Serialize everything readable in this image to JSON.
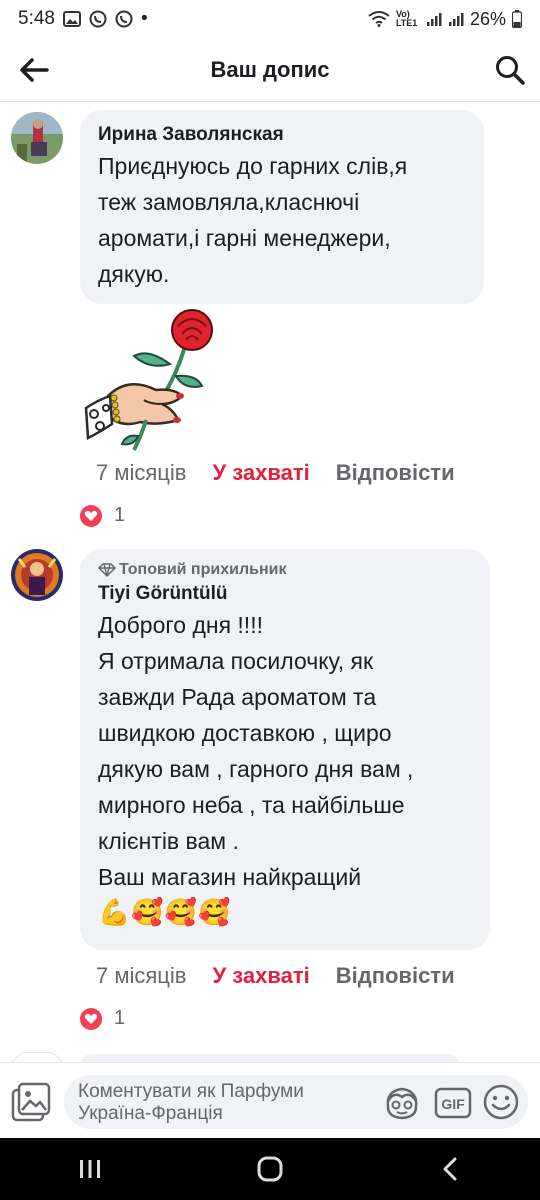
{
  "status_bar": {
    "time": "5:48",
    "dot": "•",
    "network_label": "Vo) LTE1",
    "battery": "26%",
    "icons": [
      "image-icon",
      "viber-icon",
      "viber-icon",
      "wifi-icon",
      "signal-icon",
      "signal-icon",
      "battery-icon"
    ]
  },
  "header": {
    "title": "Ваш допис",
    "back_icon": "arrow-left-icon",
    "search_icon": "search-icon"
  },
  "comments": [
    {
      "author": "Ирина Заволянская",
      "text": "Приєднуюсь до гарних слів,я\nтеж замовляла,класнючі\nаромати,і гарні менеджери,\nдякую.",
      "sticker": "hand-holding-rose-sticker",
      "time": "7 місяців",
      "like_label": "У захваті",
      "reply_label": "Відповісти",
      "reaction_icon": "heart-reaction-icon",
      "reaction_count": "1"
    },
    {
      "badge": "Топовий прихильник",
      "badge_icon": "diamond-icon",
      "author": "Tiyi Görüntülü",
      "text": "Доброго дня !!!!\nЯ отримала посилочку, як\nзавжди Рада ароматом та\nшвидкою доставкою , щиро\nдякую вам , гарного дня вам ,\nмирного неба , та найбільше\nклієнтів вам .\nВаш магазин найкращий",
      "emojis": "💪🥰🥰🥰",
      "time": "7 місяців",
      "like_label": "У захваті",
      "reply_label": "Відповісти",
      "reaction_icon": "heart-reaction-icon",
      "reaction_count": "1"
    }
  ],
  "composer": {
    "placeholder": "Коментувати як Парфуми Україна-Франція",
    "icons": [
      "photo-icon",
      "avatar-sticker-icon",
      "gif-icon",
      "emoji-icon"
    ],
    "gif_label": "GIF"
  },
  "navbar": {
    "icons": [
      "recent-apps-icon",
      "home-icon",
      "back-icon"
    ]
  },
  "colors": {
    "accent_like": "#e41e3f",
    "heart": "#f33e58",
    "bubble": "#f0f2f5",
    "secondary_text": "#65676b"
  }
}
